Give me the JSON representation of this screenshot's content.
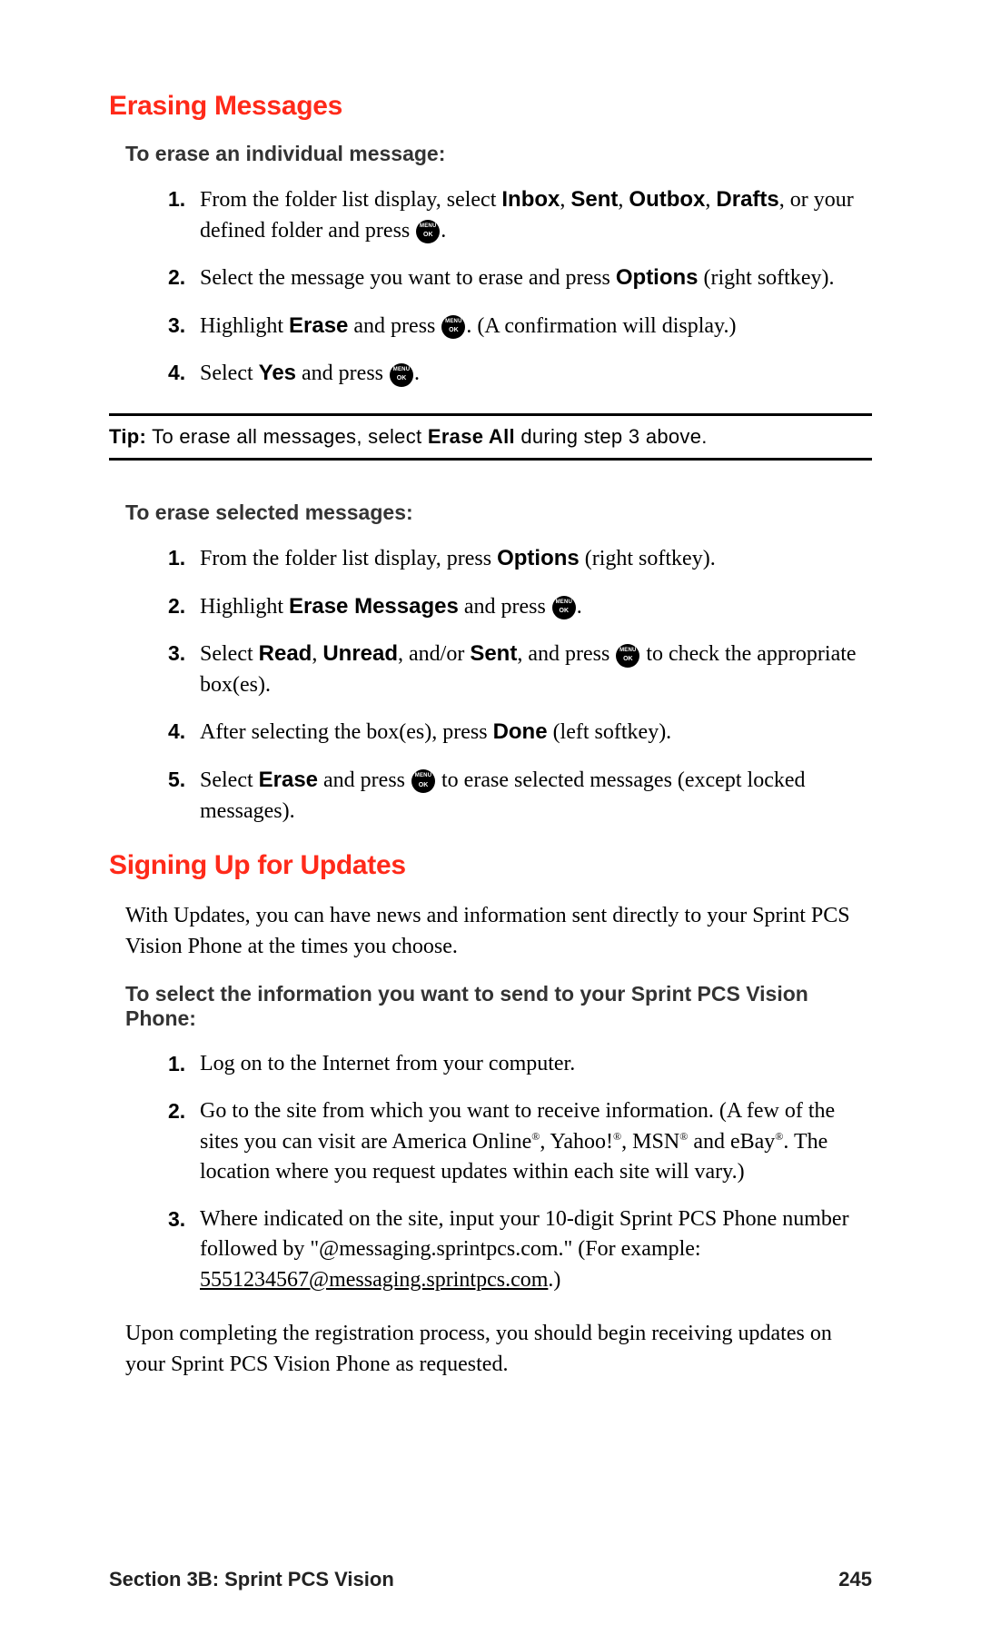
{
  "section1": {
    "title": "Erasing Messages",
    "sub1": "To erase an individual message:",
    "steps1": [
      {
        "num": "1.",
        "pre": "From the folder list display, select ",
        "b1": "Inbox",
        "c1": ", ",
        "b2": "Sent",
        "c2": ", ",
        "b3": "Outbox",
        "c3": ", ",
        "b4": "Drafts",
        "post": ", or your defined folder and press ",
        "icon": true,
        "post2": "."
      },
      {
        "num": "2.",
        "pre": "Select the message you want to erase and press ",
        "b1": "Options",
        "post": " (right softkey)."
      },
      {
        "num": "3.",
        "pre": "Highlight ",
        "b1": "Erase",
        "post": " and press ",
        "icon": true,
        "post2": ". (A confirmation will display.)"
      },
      {
        "num": "4.",
        "pre": "Select ",
        "b1": "Yes",
        "post": " and press ",
        "icon": true,
        "post2": "."
      }
    ],
    "tip": {
      "label": "Tip:",
      "pre": " To erase all messages, select ",
      "bold": "Erase All",
      "post": " during step 3 above."
    },
    "sub2": "To erase selected messages:",
    "steps2": [
      {
        "num": "1.",
        "pre": "From the folder list display, press ",
        "b1": "Options",
        "post": " (right softkey)."
      },
      {
        "num": "2.",
        "pre": "Highlight ",
        "b1": "Erase Messages",
        "post": " and press ",
        "icon": true,
        "post2": "."
      },
      {
        "num": "3.",
        "pre": "Select ",
        "b1": "Read",
        "c1": ", ",
        "b2": "Unread",
        "c2": ", and/or ",
        "b3": "Sent",
        "post": ", and press ",
        "icon": true,
        "post2": " to check the appropriate box(es)."
      },
      {
        "num": "4.",
        "pre": "After selecting the box(es), press ",
        "b1": "Done",
        "post": " (left softkey)."
      },
      {
        "num": "5.",
        "pre": "Select ",
        "b1": "Erase",
        "post": " and press ",
        "icon": true,
        "post2": " to erase selected messages (except locked messages)."
      }
    ]
  },
  "section2": {
    "title": "Signing Up for Updates",
    "intro": "With Updates, you can have news and information sent directly to your Sprint PCS Vision Phone at the times you choose.",
    "sub": "To select the information you want to send to your Sprint PCS Vision Phone:",
    "steps": [
      {
        "num": "1.",
        "text": "Log on to the Internet from your computer."
      },
      {
        "num": "2.",
        "text_parts": [
          "Go to the site from which you want to receive information. (A few of the sites you can visit are America Online",
          "®",
          ", Yahoo!",
          "®",
          ", MSN",
          "®",
          " and eBay",
          "®",
          ". The location where you request updates within each site will vary.)"
        ]
      },
      {
        "num": "3.",
        "pre": "Where indicated on the site, input your 10-digit Sprint PCS Phone number followed by \"@messaging.sprintpcs.com.\" (For example: ",
        "link": "5551234567@messaging.sprintpcs.com",
        "post": ".)"
      }
    ],
    "closing": "Upon completing the registration process, you should begin receiving updates on your Sprint PCS Vision Phone as requested."
  },
  "footer": {
    "section": "Section 3B: Sprint PCS Vision",
    "page": "245"
  }
}
